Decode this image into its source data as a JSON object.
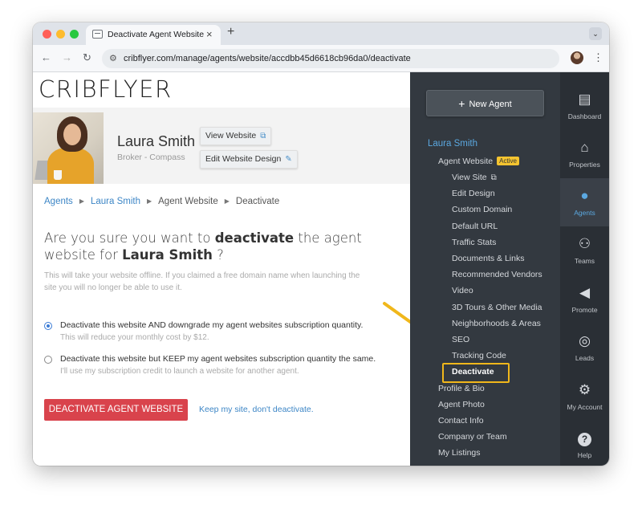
{
  "browser": {
    "tab_title": "Deactivate Agent Website",
    "tab_close": "×",
    "new_tab": "+",
    "tab_menu": "⌄",
    "url": "cribflyer.com/manage/agents/website/accdbb45d6618cb96da0/deactivate",
    "back": "←",
    "forward": "→",
    "reload": "↻",
    "star": "☆",
    "menu": "⋮",
    "traffic_colors": [
      "#ff5f57",
      "#febc2e",
      "#28c840"
    ]
  },
  "brand": "CRIBFLYER",
  "agent": {
    "name": "Laura Smith",
    "subtitle": "Broker - Compass",
    "view_website": "View Website",
    "edit_design": "Edit Website Design"
  },
  "breadcrumb": [
    "Agents",
    "Laura Smith",
    "Agent Website",
    "Deactivate"
  ],
  "question": {
    "pre": "Are you sure you want to ",
    "bold1": "deactivate",
    "mid": " the agent website for ",
    "bold2": "Laura Smith",
    "end": " ?"
  },
  "explain": "This will take your website offline. If you claimed a free domain name when launching the site you will no longer be able to use it.",
  "options": [
    {
      "label": "Deactivate this website AND downgrade my agent websites subscription quantity.",
      "sub": "This will reduce your monthly cost by $12.",
      "selected": true
    },
    {
      "label": "Deactivate this website but KEEP my agent websites subscription quantity the same.",
      "sub": "I'll use my subscription credit to launch a website for another agent.",
      "selected": false
    }
  ],
  "actions": {
    "deactivate": "DEACTIVATE AGENT WEBSITE",
    "keep": "Keep my site, don't deactivate."
  },
  "sidebar": {
    "new_agent": "New Agent",
    "agent_name": "Laura Smith",
    "agent_website": "Agent Website",
    "active_badge": "Active",
    "sub_items": [
      "View Site",
      "Edit Design",
      "Custom Domain",
      "Default URL",
      "Traffic Stats",
      "Documents & Links",
      "Recommended Vendors",
      "Video",
      "3D Tours & Other Media",
      "Neighborhoods & Areas",
      "SEO",
      "Tracking Code",
      "Deactivate"
    ],
    "items": [
      "Profile & Bio",
      "Agent Photo",
      "Contact Info",
      "Company or Team",
      "My Listings"
    ]
  },
  "iconbar": [
    {
      "label": "Dashboard",
      "icon": "dashboard-icon",
      "glyph": "▤",
      "active": false
    },
    {
      "label": "Properties",
      "icon": "properties-icon",
      "glyph": "⌂",
      "active": false
    },
    {
      "label": "Agents",
      "icon": "agents-icon",
      "glyph": "●",
      "active": true
    },
    {
      "label": "Teams",
      "icon": "teams-icon",
      "glyph": "⚇",
      "active": false
    },
    {
      "label": "Promote",
      "icon": "megaphone-icon",
      "glyph": "◀",
      "active": false
    },
    {
      "label": "Leads",
      "icon": "target-icon",
      "glyph": "◎",
      "active": false
    },
    {
      "label": "My Account",
      "icon": "gear-icon",
      "glyph": "⚙",
      "active": false
    },
    {
      "label": "Help",
      "icon": "help-icon",
      "glyph": "?",
      "active": false
    }
  ],
  "colors": {
    "accent": "#3d86c6",
    "danger": "#d9434c",
    "highlight": "#f0b71b",
    "sidebar": "#333940"
  }
}
